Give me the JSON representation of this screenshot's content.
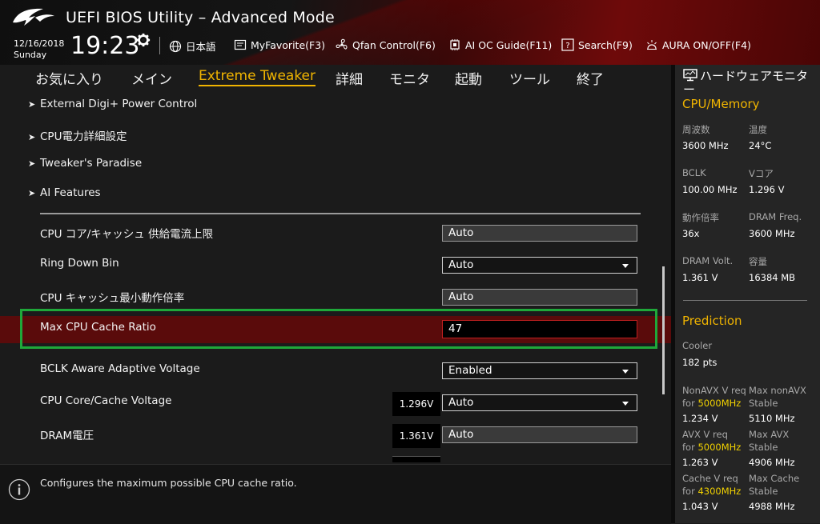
{
  "header": {
    "title": "UEFI BIOS Utility – Advanced Mode",
    "date": "12/16/2018",
    "weekday": "Sunday",
    "time": "19:23",
    "toolbar": [
      {
        "icon": "globe-icon",
        "label": "日本語"
      },
      {
        "icon": "my-favorite-icon",
        "label": "MyFavorite(F3)"
      },
      {
        "icon": "fan-icon",
        "label": "Qfan Control(F6)"
      },
      {
        "icon": "ai-oc-guide-icon",
        "label": "AI OC Guide(F11)"
      },
      {
        "icon": "search-icon",
        "label": "Search(F9)"
      },
      {
        "icon": "aura-icon",
        "label": "AURA ON/OFF(F4)"
      }
    ]
  },
  "tabs": [
    {
      "label": "お気に入り",
      "active": false
    },
    {
      "label": "メイン",
      "active": false
    },
    {
      "label": "Extreme Tweaker",
      "active": true
    },
    {
      "label": "詳細",
      "active": false
    },
    {
      "label": "モニタ",
      "active": false
    },
    {
      "label": "起動",
      "active": false
    },
    {
      "label": "ツール",
      "active": false
    },
    {
      "label": "終了",
      "active": false
    }
  ],
  "submenus": [
    "External Digi+ Power Control",
    "CPU電力詳細設定",
    "Tweaker's Paradise",
    "AI Features"
  ],
  "settings": [
    {
      "label": "CPU コア/キャッシュ 供給電流上限",
      "value": "Auto",
      "type": "text"
    },
    {
      "label": "Ring Down Bin",
      "value": "Auto",
      "type": "select"
    },
    {
      "label": "CPU キャッシュ最小動作倍率",
      "value": "Auto",
      "type": "text"
    },
    {
      "label": "Max CPU Cache Ratio",
      "value": "47",
      "type": "input",
      "selected": true
    },
    {
      "label": "BCLK Aware Adaptive Voltage",
      "value": "Enabled",
      "type": "select"
    },
    {
      "label": "CPU Core/Cache Voltage",
      "value": "Auto",
      "type": "select",
      "voltage": "1.296V"
    },
    {
      "label": "DRAM電圧",
      "value": "Auto",
      "type": "text",
      "voltage": "1.361V"
    }
  ],
  "help": {
    "text": "Configures the maximum possible CPU cache ratio."
  },
  "hw_monitor": {
    "title": "ハードウェアモニター",
    "cpu_section": "CPU/Memory",
    "cpu_items": [
      {
        "label": "周波数",
        "value": "3600 MHz"
      },
      {
        "label": "温度",
        "value": "24°C"
      },
      {
        "label": "BCLK",
        "value": "100.00 MHz"
      },
      {
        "label": "Vコア",
        "value": "1.296 V"
      },
      {
        "label": "動作倍率",
        "value": "36x"
      },
      {
        "label": "DRAM Freq.",
        "value": "3600 MHz"
      },
      {
        "label": "DRAM Volt.",
        "value": "1.361 V"
      },
      {
        "label": "容量",
        "value": "16384 MB"
      }
    ],
    "prediction_section": "Prediction",
    "cooler_label": "Cooler",
    "cooler_value": "182 pts",
    "predictions": [
      {
        "label": "NonAVX V req",
        "for": "for",
        "freq": "5000MHz",
        "value": "1.234 V",
        "label2": "Max nonAVX",
        "sub2": "Stable",
        "value2": "5110 MHz"
      },
      {
        "label": "AVX V req",
        "for": "for",
        "freq": "5000MHz",
        "value": "1.263 V",
        "label2": "Max AVX",
        "sub2": "Stable",
        "value2": "4906 MHz"
      },
      {
        "label": "Cache V req",
        "for": "for",
        "freq": "4300MHz",
        "value": "1.043 V",
        "label2": "Max Cache",
        "sub2": "Stable",
        "value2": "4988 MHz"
      }
    ]
  },
  "colors": {
    "accent": "#f0b400",
    "selected_row": "#5a0b0b",
    "highlight_box": "#1fa83a",
    "prediction_freq": "#f0d000"
  }
}
